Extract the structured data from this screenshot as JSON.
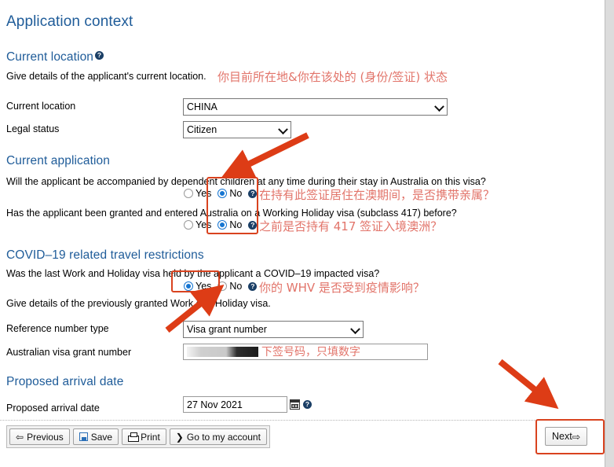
{
  "page": {
    "title": "Application context"
  },
  "current_location": {
    "heading": "Current location",
    "help_icon": "help-icon",
    "description": "Give details of the applicant's current location.",
    "annotation": "你目前所在地&你在该处的 (身份/签证) 状态",
    "fields": {
      "current_location_label": "Current location",
      "current_location_value": "CHINA",
      "legal_status_label": "Legal status",
      "legal_status_value": "Citizen"
    }
  },
  "current_application": {
    "heading": "Current application",
    "question1": {
      "text": "Will the applicant be accompanied by dependent children at any time during their stay in Australia on this visa?",
      "yes_label": "Yes",
      "no_label": "No",
      "selected": "No",
      "annotation": "在持有此签证居住在澳期间，是否携带亲属？"
    },
    "question2": {
      "text": "Has the applicant been granted and entered Australia on a Working Holiday visa (subclass 417) before?",
      "yes_label": "Yes",
      "no_label": "No",
      "selected": "No",
      "annotation": "之前是否持有 417 签证入境澳洲？"
    }
  },
  "covid": {
    "heading": "COVID–19 related travel restrictions",
    "question": {
      "text": "Was the last Work and Holiday visa held by the applicant a COVID–19 impacted visa?",
      "yes_label": "Yes",
      "no_label": "No",
      "selected": "Yes",
      "annotation": "你的 WHV 是否受到疫情影响？"
    },
    "detail_text": "Give details of the previously granted Work and Holiday visa.",
    "reference_number_type_label": "Reference number type",
    "reference_number_type_value": "Visa grant number",
    "grant_number_label": "Australian visa grant number",
    "grant_number_value": "",
    "grant_number_annotation": "下签号码，只填数字"
  },
  "arrival": {
    "heading": "Proposed arrival date",
    "label": "Proposed arrival date",
    "value": "27 Nov 2021",
    "calendar_icon": "calendar-icon",
    "help_icon": "help-icon"
  },
  "toolbar": {
    "previous_label": "Previous",
    "previous_glyph": "⇦",
    "save_label": "Save",
    "print_label": "Print",
    "account_label": "Go to my account",
    "account_glyph": "❯",
    "next_label": "Next",
    "next_glyph": "⇨"
  },
  "colors": {
    "heading_blue": "#1f5c99",
    "annotation_red": "#e2746a",
    "highlight_red": "#d9431f",
    "radio_blue": "#1675d1"
  }
}
